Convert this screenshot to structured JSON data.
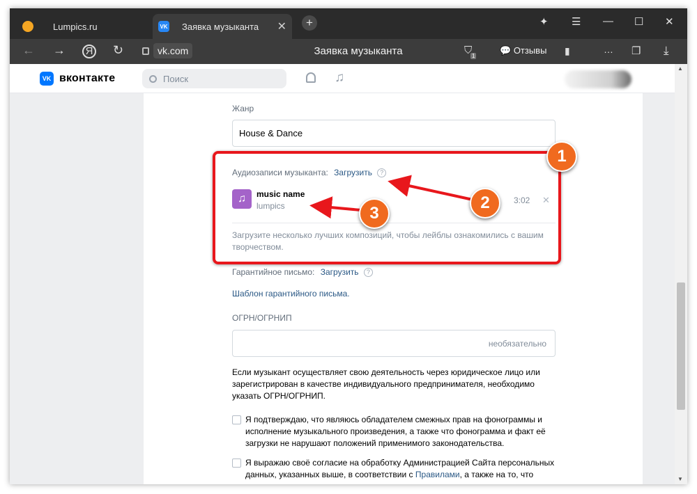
{
  "browser": {
    "tabs": [
      {
        "label": "Lumpics.ru"
      },
      {
        "label": "Заявка музыканта"
      }
    ],
    "url": "vk.com",
    "page_title": "Заявка музыканта",
    "reviews_label": "Отзывы",
    "tab_badge_count": "1",
    "accent_color": "#e8171c"
  },
  "vk": {
    "logo_text": "вконтакте",
    "logo_mark": "VK",
    "search_placeholder": "Поиск"
  },
  "form": {
    "genre_label": "Жанр",
    "genre_value": "House & Dance",
    "audio_label": "Аудиозаписи музыканта:",
    "audio_upload": "Загрузить",
    "track": {
      "title": "music name",
      "artist": "lumpics",
      "duration": "3:02"
    },
    "audio_hint": "Загрузите несколько лучших композиций, чтобы лейблы ознакомились с вашим творчеством.",
    "guarantee_label": "Гарантийное письмо:",
    "guarantee_upload": "Загрузить",
    "guarantee_template": "Шаблон гарантийного письма.",
    "ogrn_label": "ОГРН/ОГРНИП",
    "ogrn_placeholder": "необязательно",
    "ogrn_info": "Если музыкант осуществляет свою деятельность через юридическое лицо или зарегистрирован в качестве индивидуального предпринимателя, необходимо указать ОГРН/ОГРНИП.",
    "confirm_text": "Я подтверждаю, что являюсь обладателем смежных прав на фонограммы и исполнение музыкального произведения, а также что фонограмма и факт её загрузки не нарушают положений применимого законодательства.",
    "consent_text_1": "Я выражаю своё согласие на обработку Администрацией Сайта персональных данных, указанных выше, в соответствии с",
    "consent_link": "Правилами",
    "consent_text_2": ", а также на то, что сведения,"
  },
  "annotations": {
    "badge1": "1",
    "badge2": "2",
    "badge3": "3"
  }
}
